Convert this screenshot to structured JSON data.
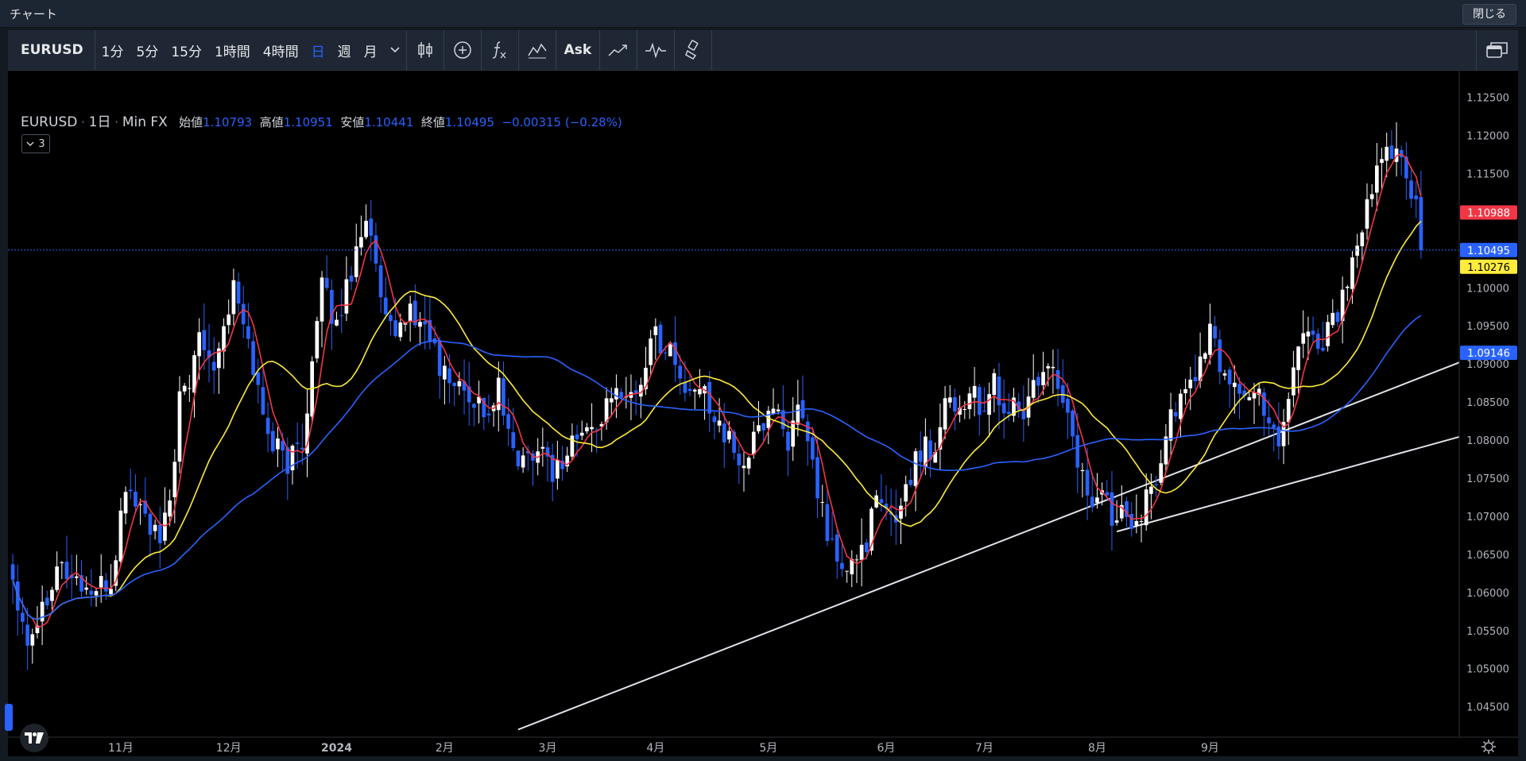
{
  "window": {
    "title": "チャート",
    "close_label": "閉じる"
  },
  "toolbar": {
    "symbol": "EURUSD",
    "intervals": [
      "1分",
      "5分",
      "15分",
      "1時間",
      "4時間",
      "日",
      "週",
      "月"
    ],
    "active_interval": "日",
    "ask_label": "Ask",
    "icons": [
      "candlestick-icon",
      "plus-circle-icon",
      "function-icon",
      "indicators-icon",
      "compare-icon",
      "trend-icon",
      "brush-icon"
    ]
  },
  "legend": {
    "symbol": "EURUSD",
    "interval": "1日",
    "source": "Min FX",
    "open_label": "始値",
    "open": "1.10793",
    "high_label": "高値",
    "high": "1.10951",
    "low_label": "安値",
    "low": "1.10441",
    "close_label": "終値",
    "close": "1.10495",
    "change": "−0.00315 (−0.28%)",
    "collapse_label": "3"
  },
  "chart_data": {
    "type": "candlestick",
    "symbol": "EURUSD",
    "interval": "1日",
    "ylim": [
      1.041,
      1.1285
    ],
    "y_ticks": [
      "1.12500",
      "1.12000",
      "1.11500",
      "1.11000",
      "1.10000",
      "1.09500",
      "1.09000",
      "1.08500",
      "1.08000",
      "1.07500",
      "1.07000",
      "1.06500",
      "1.06000",
      "1.05500",
      "1.05000",
      "1.04500"
    ],
    "x_labels": [
      "11月",
      "12月",
      "2024",
      "2月",
      "3月",
      "4月",
      "5月",
      "6月",
      "7月",
      "8月",
      "9月"
    ],
    "price_labels": [
      {
        "value": 1.10988,
        "text": "1.10988",
        "color": "#f23645"
      },
      {
        "value": 1.10495,
        "text": "1.10495",
        "color": "#2962ff"
      },
      {
        "value": 1.10276,
        "text": "1.10276",
        "color": "#ffeb3b"
      },
      {
        "value": 1.09146,
        "text": "1.09146",
        "color": "#2962ff"
      }
    ],
    "last_price": 1.10495,
    "anchors_close": [
      [
        0,
        1.062
      ],
      [
        3,
        1.054
      ],
      [
        6,
        1.058
      ],
      [
        9,
        1.064
      ],
      [
        12,
        1.062
      ],
      [
        16,
        1.06
      ],
      [
        20,
        1.061
      ],
      [
        23,
        1.074
      ],
      [
        27,
        1.07
      ],
      [
        30,
        1.066
      ],
      [
        32,
        1.072
      ],
      [
        34,
        1.085
      ],
      [
        36,
        1.087
      ],
      [
        38,
        1.095
      ],
      [
        41,
        1.09
      ],
      [
        43,
        1.095
      ],
      [
        45,
        1.1
      ],
      [
        47,
        1.095
      ],
      [
        49,
        1.09
      ],
      [
        51,
        1.083
      ],
      [
        53,
        1.08
      ],
      [
        56,
        1.077
      ],
      [
        59,
        1.08
      ],
      [
        61,
        1.09
      ],
      [
        63,
        1.1
      ],
      [
        66,
        1.095
      ],
      [
        68,
        1.1
      ],
      [
        70,
        1.105
      ],
      [
        72,
        1.11
      ],
      [
        74,
        1.102
      ],
      [
        76,
        1.095
      ],
      [
        78,
        1.093
      ],
      [
        80,
        1.097
      ],
      [
        82,
        1.096
      ],
      [
        85,
        1.094
      ],
      [
        87,
        1.089
      ],
      [
        89,
        1.088
      ],
      [
        91,
        1.087
      ],
      [
        93,
        1.086
      ],
      [
        95,
        1.085
      ],
      [
        97,
        1.083
      ],
      [
        99,
        1.087
      ],
      [
        101,
        1.08
      ],
      [
        104,
        1.077
      ],
      [
        106,
        1.079
      ],
      [
        108,
        1.079
      ],
      [
        110,
        1.076
      ],
      [
        112,
        1.077
      ],
      [
        114,
        1.08
      ],
      [
        117,
        1.081
      ],
      [
        120,
        1.083
      ],
      [
        122,
        1.085
      ],
      [
        124,
        1.087
      ],
      [
        126,
        1.086
      ],
      [
        128,
        1.087
      ],
      [
        130,
        1.094
      ],
      [
        132,
        1.093
      ],
      [
        134,
        1.092
      ],
      [
        136,
        1.088
      ],
      [
        138,
        1.085
      ],
      [
        140,
        1.087
      ],
      [
        142,
        1.085
      ],
      [
        145,
        1.081
      ],
      [
        147,
        1.078
      ],
      [
        149,
        1.077
      ],
      [
        152,
        1.081
      ],
      [
        154,
        1.084
      ],
      [
        156,
        1.084
      ],
      [
        158,
        1.08
      ],
      [
        160,
        1.083
      ],
      [
        162,
        1.08
      ],
      [
        164,
        1.073
      ],
      [
        166,
        1.068
      ],
      [
        168,
        1.064
      ],
      [
        170,
        1.062
      ],
      [
        172,
        1.065
      ],
      [
        174,
        1.067
      ],
      [
        176,
        1.072
      ],
      [
        178,
        1.07
      ],
      [
        180,
        1.07
      ],
      [
        182,
        1.074
      ],
      [
        184,
        1.077
      ],
      [
        186,
        1.08
      ],
      [
        188,
        1.078
      ],
      [
        190,
        1.087
      ],
      [
        192,
        1.084
      ],
      [
        194,
        1.085
      ],
      [
        196,
        1.087
      ],
      [
        198,
        1.082
      ],
      [
        200,
        1.088
      ],
      [
        202,
        1.083
      ],
      [
        204,
        1.085
      ],
      [
        206,
        1.083
      ],
      [
        208,
        1.087
      ],
      [
        210,
        1.088
      ],
      [
        212,
        1.089
      ],
      [
        214,
        1.086
      ],
      [
        216,
        1.08
      ],
      [
        218,
        1.075
      ],
      [
        220,
        1.072
      ],
      [
        222,
        1.073
      ],
      [
        224,
        1.07
      ],
      [
        226,
        1.072
      ],
      [
        228,
        1.07
      ],
      [
        230,
        1.071
      ],
      [
        232,
        1.073
      ],
      [
        234,
        1.078
      ],
      [
        236,
        1.083
      ],
      [
        238,
        1.085
      ],
      [
        240,
        1.088
      ],
      [
        242,
        1.09
      ],
      [
        244,
        1.094
      ],
      [
        246,
        1.09
      ],
      [
        248,
        1.088
      ],
      [
        250,
        1.087
      ],
      [
        252,
        1.085
      ],
      [
        254,
        1.086
      ],
      [
        256,
        1.083
      ],
      [
        258,
        1.08
      ],
      [
        260,
        1.086
      ],
      [
        262,
        1.093
      ],
      [
        264,
        1.095
      ],
      [
        266,
        1.092
      ],
      [
        268,
        1.095
      ],
      [
        270,
        1.097
      ],
      [
        272,
        1.1
      ],
      [
        274,
        1.105
      ],
      [
        276,
        1.11
      ],
      [
        278,
        1.115
      ],
      [
        280,
        1.118
      ],
      [
        282,
        1.119
      ],
      [
        284,
        1.114
      ],
      [
        286,
        1.11
      ],
      [
        287,
        1.105
      ]
    ],
    "moving_averages": [
      {
        "name": "MA short",
        "color": "#f23645"
      },
      {
        "name": "MA mid",
        "color": "#ffeb3b"
      },
      {
        "name": "MA long",
        "color": "#2962ff"
      }
    ],
    "trendlines": [
      {
        "from": [
          103,
          1.042
        ],
        "to": [
          298,
          1.091
        ]
      },
      {
        "from": [
          225,
          1.068
        ],
        "to": [
          298,
          1.081
        ]
      }
    ],
    "grid": false
  }
}
